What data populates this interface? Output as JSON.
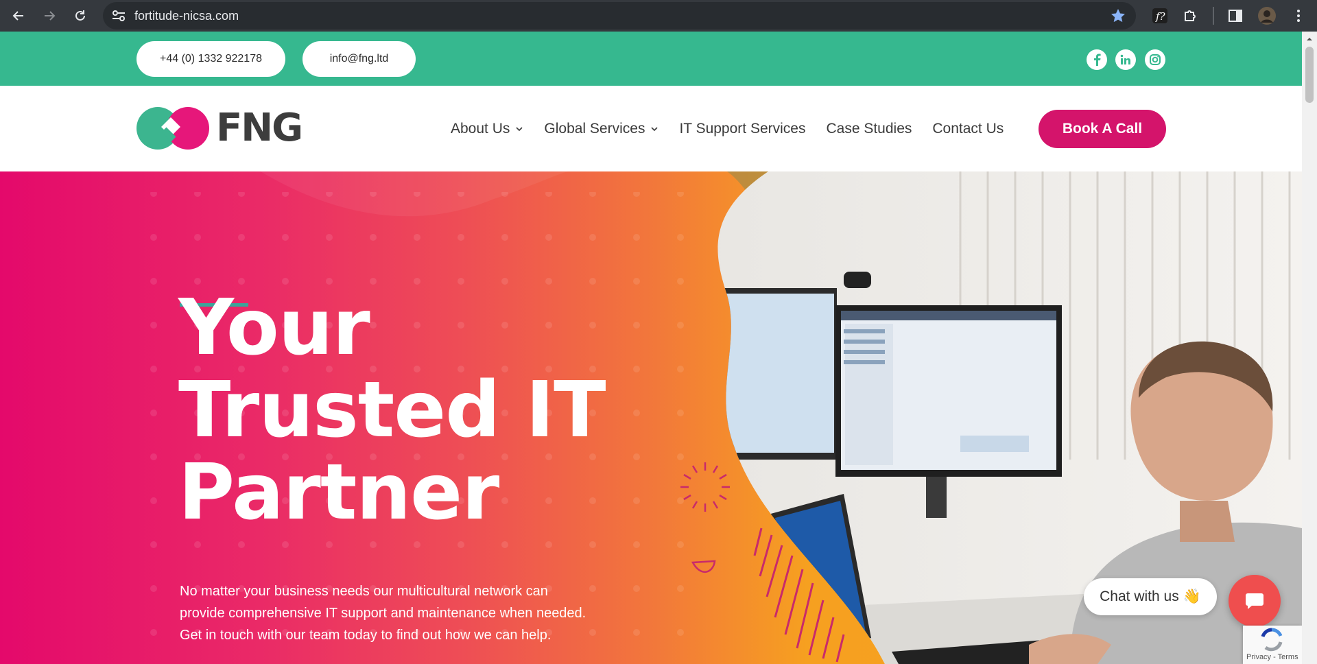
{
  "browser": {
    "url": "fortitude-nicsa.com",
    "icons": [
      "back-arrow-icon",
      "forward-arrow-icon",
      "reload-icon",
      "site-info-icon",
      "bookmark-star-icon",
      "font-extension-icon",
      "extensions-puzzle-icon",
      "side-panel-icon",
      "profile-avatar",
      "more-menu-icon"
    ]
  },
  "topbar": {
    "phone": "+44 (0) 1332 922178",
    "email": "info@fng.ltd",
    "social": [
      "facebook-icon",
      "linkedin-icon",
      "instagram-icon"
    ],
    "bg_color": "#36b88f"
  },
  "header": {
    "logo_text": "FNG",
    "nav": [
      {
        "label": "About Us",
        "dropdown": true
      },
      {
        "label": "Global Services",
        "dropdown": true
      },
      {
        "label": "IT Support Services",
        "dropdown": false
      },
      {
        "label": "Case Studies",
        "dropdown": false
      },
      {
        "label": "Contact Us",
        "dropdown": false
      }
    ],
    "cta_label": "Book A Call",
    "cta_color": "#d4146b"
  },
  "hero": {
    "headline": [
      "Your",
      "Trusted IT",
      "Partner"
    ],
    "lead_lines": [
      "No matter your business needs our multicultural network can",
      "provide comprehensive IT support and maintenance when needed.",
      "Get in touch with our team today to find out how we can help."
    ],
    "accent_line_color": "#3aa59a",
    "gradient": [
      "#e4096b",
      "#f7a51d"
    ]
  },
  "chat": {
    "label": "Chat with us",
    "emoji": "👋",
    "button_color": "#ef4e4e"
  },
  "recaptcha": {
    "label": "Privacy - Terms"
  }
}
